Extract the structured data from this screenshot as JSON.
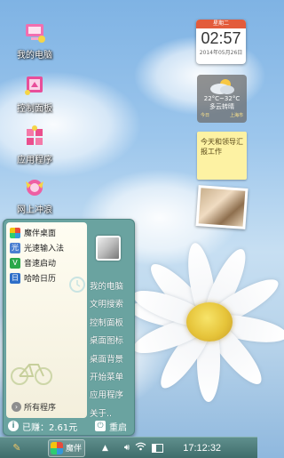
{
  "desktop": {
    "icons": [
      {
        "label": "我的电脑",
        "icon": "my-computer-icon"
      },
      {
        "label": "控制面板",
        "icon": "control-panel-icon"
      },
      {
        "label": "应用程序",
        "icon": "applications-icon"
      },
      {
        "label": "网上冲浪",
        "icon": "internet-icon"
      }
    ]
  },
  "widgets": {
    "calendar": {
      "weekday": "星期二",
      "time": "02:57",
      "date": "2014年05月26日"
    },
    "weather": {
      "temp": "22°C~32°C",
      "condition": "多云转晴",
      "day": "今日",
      "city": "上海市"
    },
    "note": {
      "text": "今天和领导汇报工作"
    }
  },
  "start_menu": {
    "apps": [
      {
        "label": "魔伴桌面",
        "icon": "mobanzhuomian-icon",
        "color": "#3aa0e0"
      },
      {
        "label": "光速输入法",
        "icon": "input-method-icon",
        "color": "#4a7fd0"
      },
      {
        "label": "音速启动",
        "icon": "quick-launch-icon",
        "color": "#2aa84a"
      },
      {
        "label": "哈哈日历",
        "icon": "calendar-app-icon",
        "color": "#2f6fc8"
      }
    ],
    "all_programs": "所有程序",
    "right_items": [
      "我的电脑",
      "文明搜索",
      "控制面板",
      "桌面图标",
      "桌面背景",
      "开始菜单",
      "应用程序",
      "关于.."
    ],
    "earned": "已赚：2.61元",
    "restart": "重启"
  },
  "taskbar": {
    "app_label": "魔伴",
    "time": "17:12:32"
  }
}
